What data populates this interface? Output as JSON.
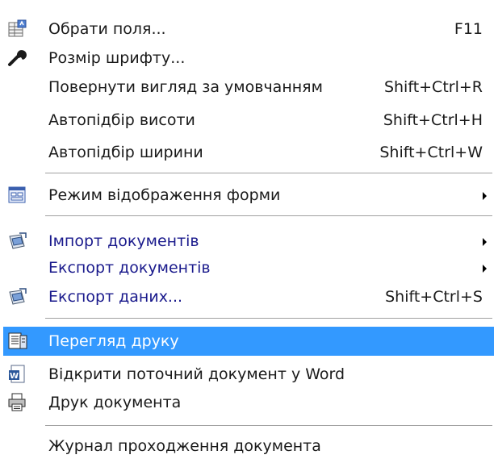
{
  "menu": {
    "items": [
      {
        "label": "Обрати поля...",
        "shortcut": "F11",
        "icon": "table-fields-icon"
      },
      {
        "label": "Розмір шрифту...",
        "shortcut": "",
        "icon": "wrench-icon"
      },
      {
        "label": "Повернути вигляд за умовчанням",
        "shortcut": "Shift+Ctrl+R"
      },
      {
        "label": "Автопідбір висоти",
        "shortcut": "Shift+Ctrl+H"
      },
      {
        "label": "Автопідбір ширини",
        "shortcut": "Shift+Ctrl+W"
      },
      {
        "label": "Режим відображення форми",
        "submenu": true,
        "icon": "form-view-icon"
      },
      {
        "label": "Імпорт документів",
        "submenu": true,
        "icon": "import-icon"
      },
      {
        "label": "Експорт документів",
        "submenu": true
      },
      {
        "label": "Експорт даних...",
        "shortcut": "Shift+Ctrl+S",
        "icon": "export-data-icon"
      },
      {
        "label": "Перегляд друку",
        "selected": true,
        "icon": "print-preview-icon"
      },
      {
        "label": "Відкрити поточний документ у Word",
        "icon": "word-icon"
      },
      {
        "label": "Друк документа",
        "icon": "printer-icon"
      },
      {
        "label": "Журнал проходження документа"
      }
    ]
  },
  "colors": {
    "selection": "#3399ff",
    "link_text": "#1a1a8c",
    "separator": "#a0a0a0"
  }
}
